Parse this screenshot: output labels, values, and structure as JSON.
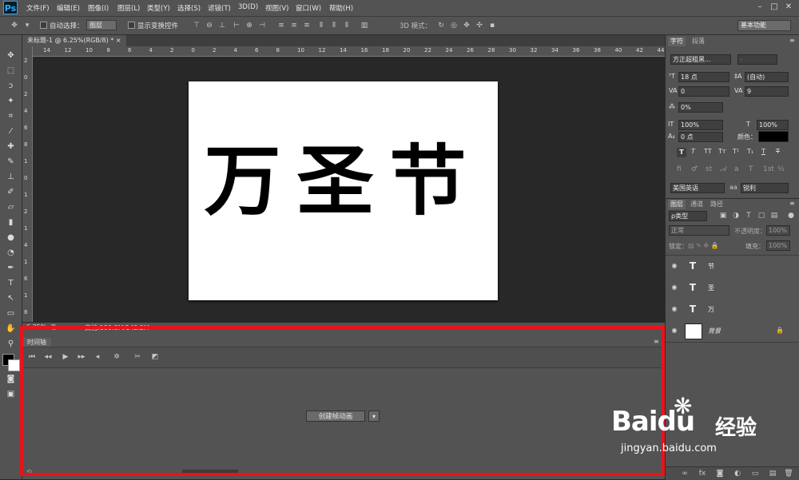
{
  "app": {
    "logo": "Ps"
  },
  "menu": [
    "文件(F)",
    "编辑(E)",
    "图像(I)",
    "图层(L)",
    "类型(Y)",
    "选择(S)",
    "滤镜(T)",
    "3D(D)",
    "视图(V)",
    "窗口(W)",
    "帮助(H)"
  ],
  "options_bar": {
    "auto_select_label": "自动选择：",
    "auto_select_value": "图层",
    "show_transform_label": "显示变换控件",
    "mode_3d_label": "3D 模式：",
    "workspace": "基本功能"
  },
  "document": {
    "tab_label": "未标题-1 @ 6.25%(RGB/8) *",
    "canvas_text": "万圣节",
    "ruler_h": [
      "14",
      "12",
      "10",
      "8",
      "6",
      "4",
      "2",
      "0",
      "2",
      "4",
      "6",
      "8",
      "10",
      "12",
      "14",
      "16",
      "18",
      "20",
      "22",
      "24",
      "26",
      "28",
      "30",
      "32",
      "34",
      "36",
      "38",
      "40",
      "42",
      "44"
    ],
    "ruler_v": [
      "2",
      "0",
      "2",
      "4",
      "6",
      "8",
      "1",
      "0",
      "1",
      "2",
      "1",
      "4",
      "1",
      "6",
      "1",
      "8"
    ]
  },
  "status": {
    "zoom": "6.25%",
    "doc_size": "文档:180.8M/142.2M"
  },
  "timeline": {
    "tab": "时间轴",
    "create_button": "创建帧动画"
  },
  "character_panel": {
    "tabs": [
      "字符",
      "段落"
    ],
    "font_family": "方正超粗黑...",
    "font_style": "-",
    "font_size": "18 点",
    "leading": "(自动)",
    "kerning": "0",
    "tracking": "9",
    "scale_pct": "0%",
    "vertical_scale": "100%",
    "horizontal_scale": "100%",
    "baseline_shift": "0 点",
    "color_label": "颜色：",
    "language": "美国英语",
    "aa_label": "aa",
    "anti_alias": "锐利"
  },
  "layers_panel": {
    "tabs": [
      "图层",
      "通道",
      "路径"
    ],
    "filter_kind": "ρ类型",
    "blend_mode": "正常",
    "opacity_label": "不透明度：",
    "opacity": "100%",
    "lock_label": "锁定：",
    "fill_label": "填充：",
    "fill": "100%",
    "layers": [
      {
        "name": "节",
        "type": "text"
      },
      {
        "name": "圣",
        "type": "text"
      },
      {
        "name": "万",
        "type": "text"
      },
      {
        "name": "背景",
        "type": "background"
      }
    ]
  },
  "watermark": {
    "brand": "Baidu",
    "cn": "经验",
    "url": "jingyan.baidu.com"
  }
}
